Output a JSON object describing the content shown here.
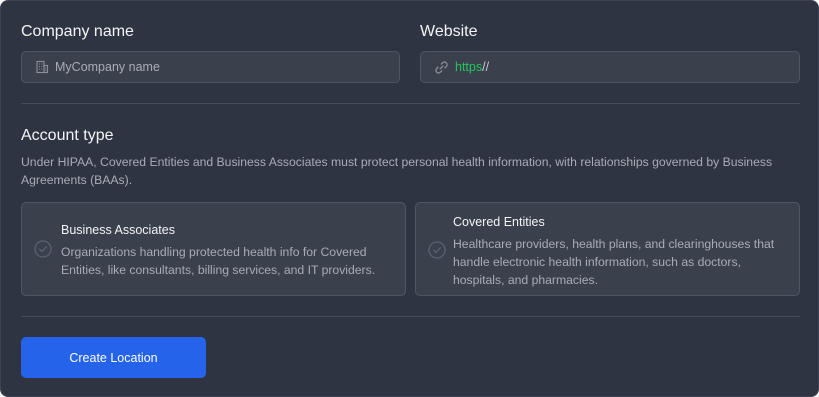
{
  "company": {
    "label": "Company name",
    "placeholder": "MyCompany name",
    "icon": "building-icon"
  },
  "website": {
    "label": "Website",
    "prefix": "https://",
    "prefix_scheme": "https",
    "prefix_sep": "//",
    "icon": "link-icon"
  },
  "account_type": {
    "title": "Account type",
    "description": "Under HIPAA, Covered Entities and Business Associates must protect personal health information, with relationships governed by Business Agreements (BAAs).",
    "options": [
      {
        "title": "Business Associates",
        "description": "Organizations handling protected health info for Covered Entities, like consultants, billing services, and IT providers.",
        "icon": "check-circle-icon"
      },
      {
        "title": "Covered Entities",
        "description": "Healthcare providers, health plans, and clearinghouses that handle electronic health information, such as doctors, hospitals, and pharmacies.",
        "icon": "check-circle-icon"
      }
    ]
  },
  "actions": {
    "create_label": "Create Location"
  },
  "colors": {
    "panel": "#2f3442",
    "input_bg": "#3b404d",
    "accent": "#2563eb",
    "https_text": "#22c55e"
  }
}
